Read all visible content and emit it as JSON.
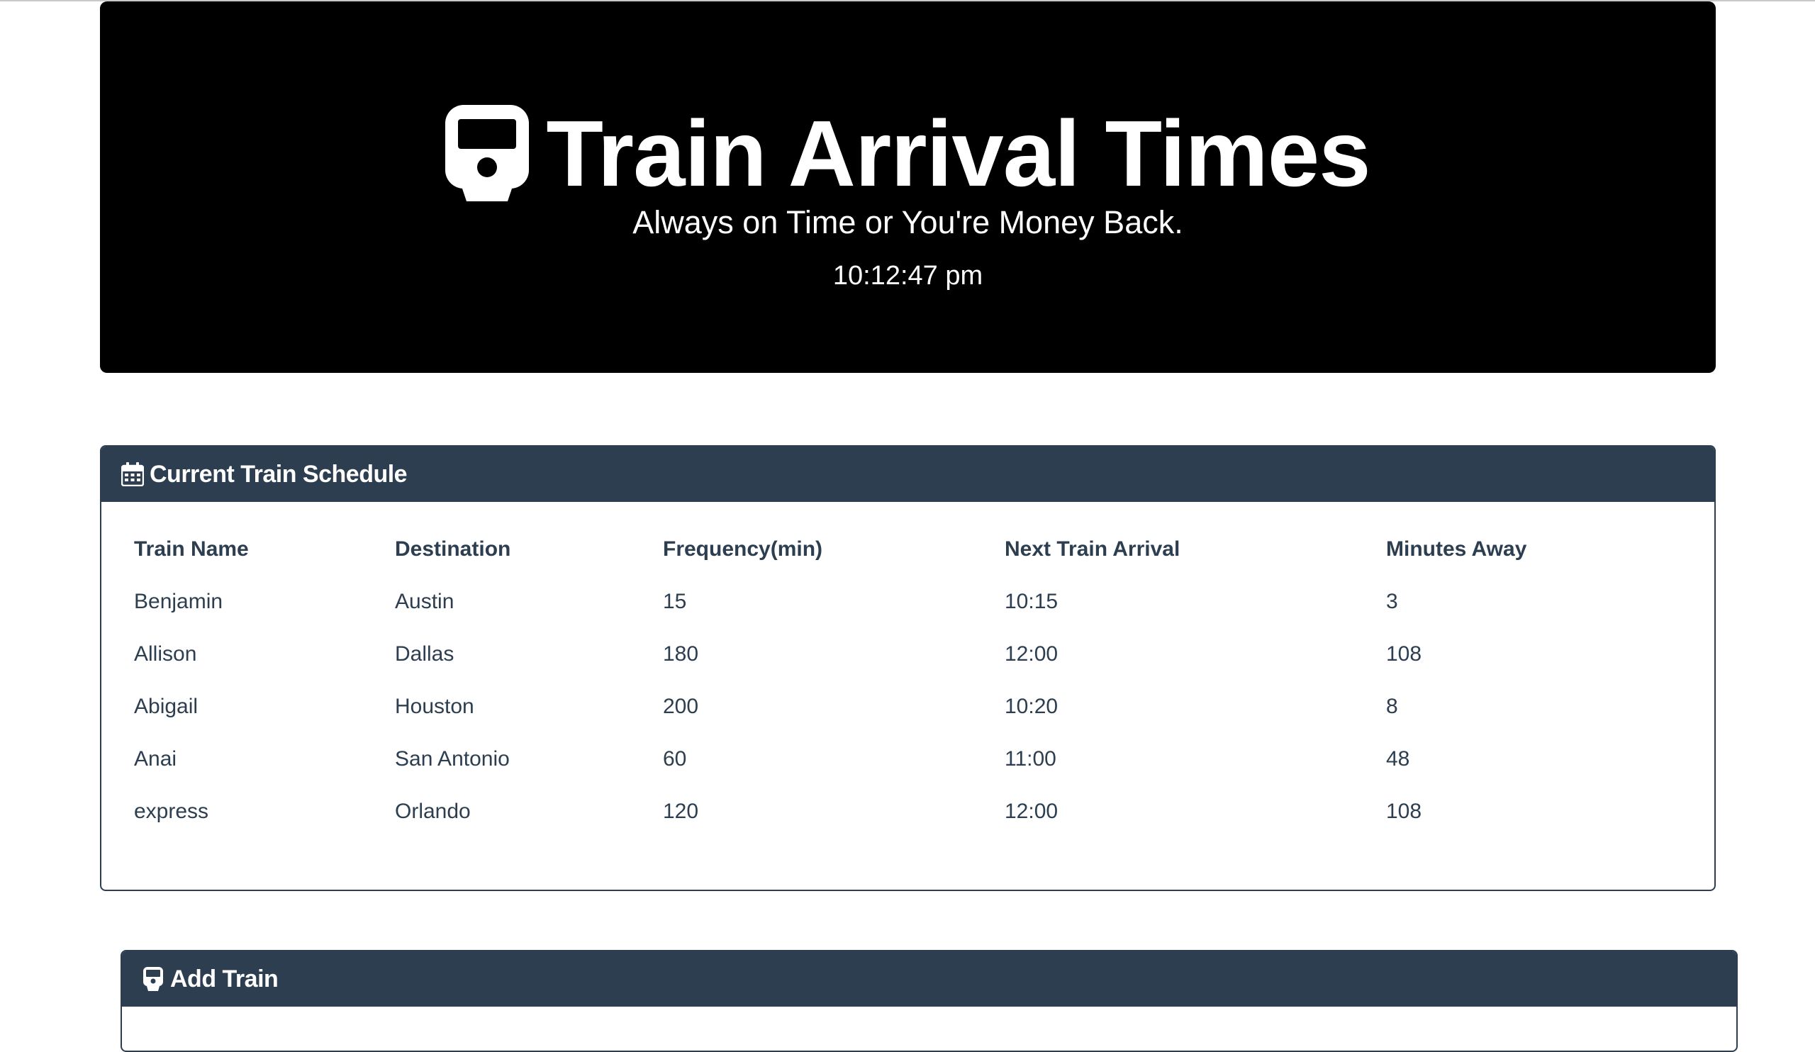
{
  "hero": {
    "title": "Train Arrival Times",
    "icon": "train-icon",
    "subtitle": "Always on Time or You're Money Back.",
    "clock": "10:12:47 pm"
  },
  "schedule": {
    "heading": "Current Train Schedule",
    "heading_icon": "calendar-icon",
    "columns": [
      "Train Name",
      "Destination",
      "Frequency(min)",
      "Next Train Arrival",
      "Minutes Away"
    ],
    "rows": [
      [
        "Benjamin",
        "Austin",
        "15",
        "10:15",
        "3"
      ],
      [
        "Allison",
        "Dallas",
        "180",
        "12:00",
        "108"
      ],
      [
        "Abigail",
        "Houston",
        "200",
        "10:20",
        "8"
      ],
      [
        "Anai",
        "San Antonio",
        "60",
        "11:00",
        "48"
      ],
      [
        "express",
        "Orlando",
        "120",
        "12:00",
        "108"
      ]
    ]
  },
  "add_train": {
    "heading": "Add Train",
    "heading_icon": "train-icon"
  },
  "colors": {
    "hero_bg": "#000000",
    "panel_heading_bg": "#2c3e50",
    "text": "#2c3e50"
  }
}
